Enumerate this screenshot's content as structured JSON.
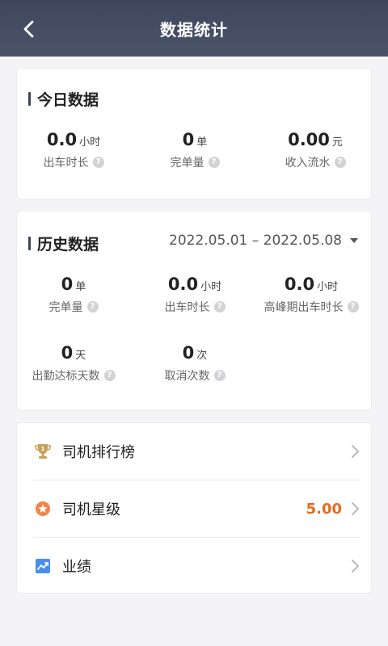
{
  "header": {
    "title": "数据统计"
  },
  "today": {
    "title": "今日数据",
    "stats": [
      {
        "value": "0.0",
        "unit": "小时",
        "label": "出车时长"
      },
      {
        "value": "0",
        "unit": "单",
        "label": "完单量"
      },
      {
        "value": "0.00",
        "unit": "元",
        "label": "收入流水"
      }
    ]
  },
  "history": {
    "title": "历史数据",
    "date_range": "2022.05.01 – 2022.05.08",
    "stats": [
      {
        "value": "0",
        "unit": "单",
        "label": "完单量"
      },
      {
        "value": "0.0",
        "unit": "小时",
        "label": "出车时长"
      },
      {
        "value": "0.0",
        "unit": "小时",
        "label": "高峰期出车时长"
      },
      {
        "value": "0",
        "unit": "天",
        "label": "出勤达标天数"
      },
      {
        "value": "0",
        "unit": "次",
        "label": "取消次数"
      }
    ]
  },
  "menu": {
    "ranking": {
      "label": "司机排行榜",
      "icon": "trophy-icon"
    },
    "star": {
      "label": "司机星级",
      "value": "5.00",
      "icon": "star-badge-icon"
    },
    "performance": {
      "label": "业绩",
      "icon": "trend-chart-icon"
    }
  },
  "colors": {
    "header": "#434b61",
    "accent_orange": "#e66a1e",
    "trophy_gold": "#c9a15a",
    "chart_blue": "#4a8ef0"
  }
}
